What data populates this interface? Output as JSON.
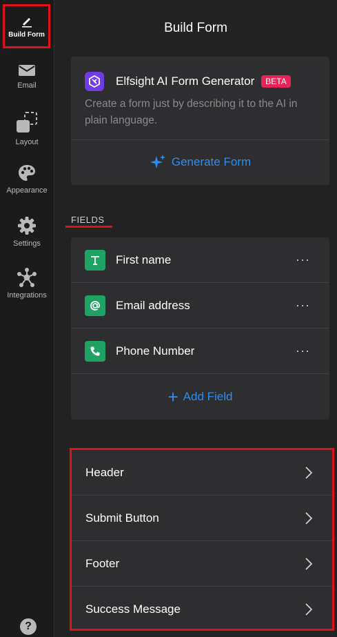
{
  "sidebar": {
    "items": [
      {
        "label": "Build Form",
        "icon": "pencil-icon"
      },
      {
        "label": "Email",
        "icon": "envelope-icon"
      },
      {
        "label": "Layout",
        "icon": "layout-icon"
      },
      {
        "label": "Appearance",
        "icon": "palette-icon"
      },
      {
        "label": "Settings",
        "icon": "gear-icon"
      },
      {
        "label": "Integrations",
        "icon": "integrations-icon"
      }
    ],
    "help": "?"
  },
  "header": {
    "title": "Build Form"
  },
  "ai_card": {
    "title": "Elfsight AI Form Generator",
    "badge": "BETA",
    "description": "Create a form just by describing it to the AI in plain language.",
    "button": "Generate Form"
  },
  "fields": {
    "section_label": "FIELDS",
    "items": [
      {
        "name": "First name",
        "icon": "text-icon",
        "menu": "···"
      },
      {
        "name": "Email address",
        "icon": "at-icon",
        "menu": "···"
      },
      {
        "name": "Phone Number",
        "icon": "phone-icon",
        "menu": "···"
      }
    ],
    "add_label": "Add Field"
  },
  "sections": {
    "items": [
      {
        "name": "Header"
      },
      {
        "name": "Submit Button"
      },
      {
        "name": "Footer"
      },
      {
        "name": "Success Message"
      }
    ]
  },
  "colors": {
    "accent": "#2d8cf0",
    "highlight": "#e0101b",
    "field_icon": "#21a265",
    "beta": "#e7245a",
    "ai_logo": "#6e3de6"
  }
}
